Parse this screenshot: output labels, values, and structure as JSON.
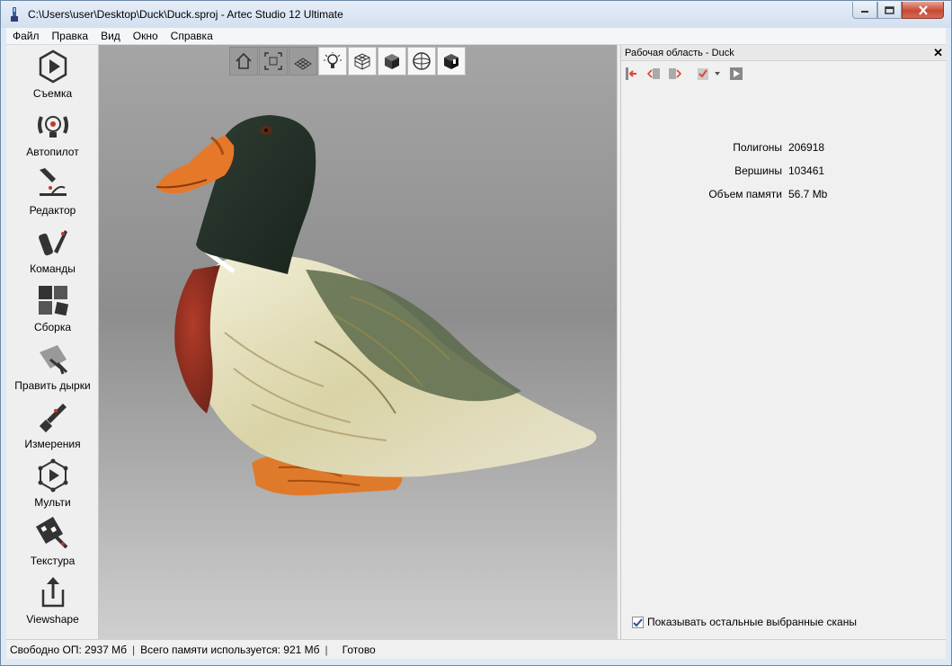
{
  "window": {
    "title": "C:\\Users\\user\\Desktop\\Duck\\Duck.sproj - Artec Studio 12 Ultimate",
    "icon": "artec-app-icon"
  },
  "menu": [
    "Файл",
    "Правка",
    "Вид",
    "Окно",
    "Справка"
  ],
  "tools": [
    {
      "label": "Съемка",
      "icon": "scan-play-icon"
    },
    {
      "label": "Автопилот",
      "icon": "autopilot-icon"
    },
    {
      "label": "Редактор",
      "icon": "eraser-editor-icon"
    },
    {
      "label": "Команды",
      "icon": "tools-knife-icon"
    },
    {
      "label": "Сборка",
      "icon": "puzzle-icon"
    },
    {
      "label": "Править дырки",
      "icon": "fill-holes-icon"
    },
    {
      "label": "Измерения",
      "icon": "measure-probe-icon"
    },
    {
      "label": "Мульти",
      "icon": "multi-network-icon"
    },
    {
      "label": "Текстура",
      "icon": "texture-brush-icon"
    },
    {
      "label": "Viewshape",
      "icon": "share-upload-icon"
    }
  ],
  "viewport_buttons": [
    {
      "icon": "home-icon",
      "state": "pressed"
    },
    {
      "icon": "fit-view-icon",
      "state": "pressed"
    },
    {
      "icon": "grid-plane-icon",
      "state": "pressed"
    },
    {
      "icon": "light-bulb-icon",
      "state": "normal"
    },
    {
      "icon": "wireframe-cube-icon",
      "state": "normal"
    },
    {
      "icon": "solid-cube-icon",
      "state": "normal"
    },
    {
      "icon": "sphere-axes-icon",
      "state": "normal"
    },
    {
      "icon": "textured-cube-icon",
      "state": "normal"
    }
  ],
  "panel": {
    "title": "Рабочая область - Duck",
    "close": "✕",
    "toolbar_icons": [
      "export-left-icon",
      "prev-icon",
      "next-icon",
      "checklist-dropdown-icon",
      "play-icon"
    ],
    "stats": [
      {
        "label": "Полигоны",
        "value": "206918"
      },
      {
        "label": "Вершины",
        "value": "103461"
      },
      {
        "label": "Объем памяти",
        "value": "56.7 Mb"
      }
    ],
    "show_other_label": "Показывать остальные выбранные сканы",
    "show_other_checked": true
  },
  "status": {
    "free_ram": "Свободно ОП: 2937 Мб",
    "total_mem": "Всего памяти используется: 921 Мб",
    "state": "Готово"
  },
  "colors": {
    "accent_red": "#d94a2f",
    "window_frame": "#dfe9f5"
  }
}
